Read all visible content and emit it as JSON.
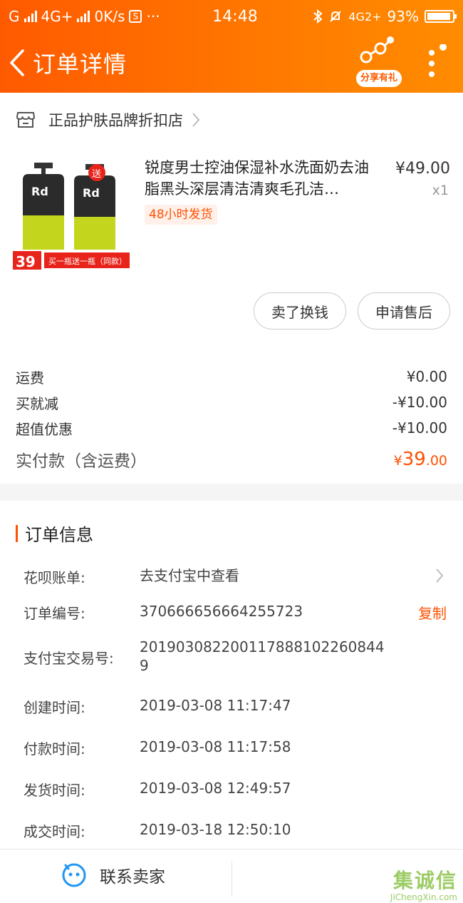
{
  "status_bar": {
    "carrier1": "G",
    "carrier2": "4G+",
    "speed": "0K/s",
    "sim_badge": "S",
    "dots": "···",
    "time": "14:48",
    "network": "4G2+",
    "battery": "93%",
    "battery_level": 0.93
  },
  "nav": {
    "title": "订单详情",
    "share_label": "分享有礼"
  },
  "store": {
    "name": "正品护肤品牌折扣店"
  },
  "product": {
    "title": "锐度男士控油保湿补水洗面奶去油脂黑头深层清洁清爽毛孔洁…",
    "price": "¥49.00",
    "qty": "x1",
    "tag": "48小时发货",
    "promo_price": "39",
    "promo_text": "买一瓶送一瓶（同款）",
    "gift_badge": "送"
  },
  "actions": {
    "sell": "卖了换钱",
    "after_sale": "申请售后"
  },
  "fees": [
    {
      "label": "运费",
      "value": "¥0.00"
    },
    {
      "label": "买就减",
      "value": "-¥10.00"
    },
    {
      "label": "超值优惠",
      "value": "-¥10.00"
    }
  ],
  "total": {
    "label": "实付款（含运费）",
    "currency": "¥",
    "integer": "39",
    "decimal": ".00"
  },
  "order_info": {
    "title": "订单信息",
    "rows": [
      {
        "label": "花呗账单:",
        "value": "去支付宝中查看"
      },
      {
        "label": "订单编号:",
        "value": "370666656664255723",
        "action": "复制"
      },
      {
        "label": "支付宝交易号:",
        "value": "2019030822001178881022608449"
      },
      {
        "label": "创建时间:",
        "value": "2019-03-08 11:17:47"
      },
      {
        "label": "付款时间:",
        "value": "2019-03-08 11:17:58"
      },
      {
        "label": "发货时间:",
        "value": "2019-03-08 12:49:57"
      },
      {
        "label": "成交时间:",
        "value": "2019-03-18 12:50:10"
      }
    ]
  },
  "bottom": {
    "contact": "联系卖家",
    "watermark": "集诚信",
    "watermark_sub": "JiChengXin.com"
  },
  "colors": {
    "accent": "#ff5000",
    "header_start": "#ff5a00",
    "header_end": "#ff8c00"
  }
}
